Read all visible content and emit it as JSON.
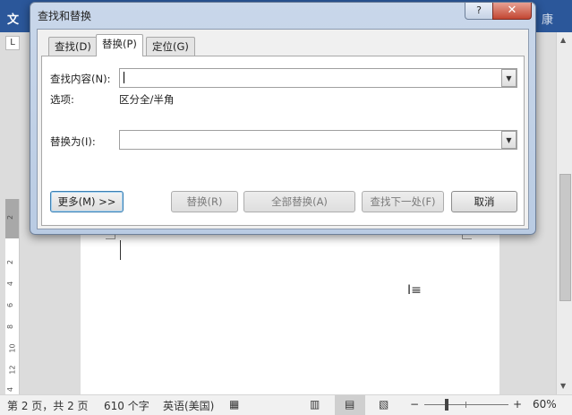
{
  "app": {
    "title_fragment": "文",
    "title_right_fragment": "康"
  },
  "ruler": {
    "corner_label": "L",
    "numbers": [
      "2",
      "2",
      "4",
      "6",
      "8",
      "10",
      "12",
      "4"
    ]
  },
  "dialog": {
    "title": "查找和替换",
    "help_label": "?",
    "close_label": "✕",
    "tabs": [
      {
        "label": "查找(D)",
        "active": false
      },
      {
        "label": "替换(P)",
        "active": true
      },
      {
        "label": "定位(G)",
        "active": false
      }
    ],
    "find": {
      "label": "查找内容(N):",
      "value": ""
    },
    "options": {
      "label": "选项:",
      "value": "区分全/半角"
    },
    "replace": {
      "label": "替换为(I):",
      "value": ""
    },
    "buttons": {
      "more": "更多(M) >>",
      "replace": "替换(R)",
      "replace_all": "全部替换(A)",
      "find_next": "查找下一处(F)",
      "cancel": "取消"
    }
  },
  "statusbar": {
    "page": "第 2 页，共 2 页",
    "words": "610 个字",
    "language": "英语(美国)",
    "zoom_minus": "−",
    "zoom_plus": "+",
    "zoom_level": "60%"
  },
  "colors": {
    "titlebar": "#2b579a",
    "close_button": "#c24632"
  }
}
